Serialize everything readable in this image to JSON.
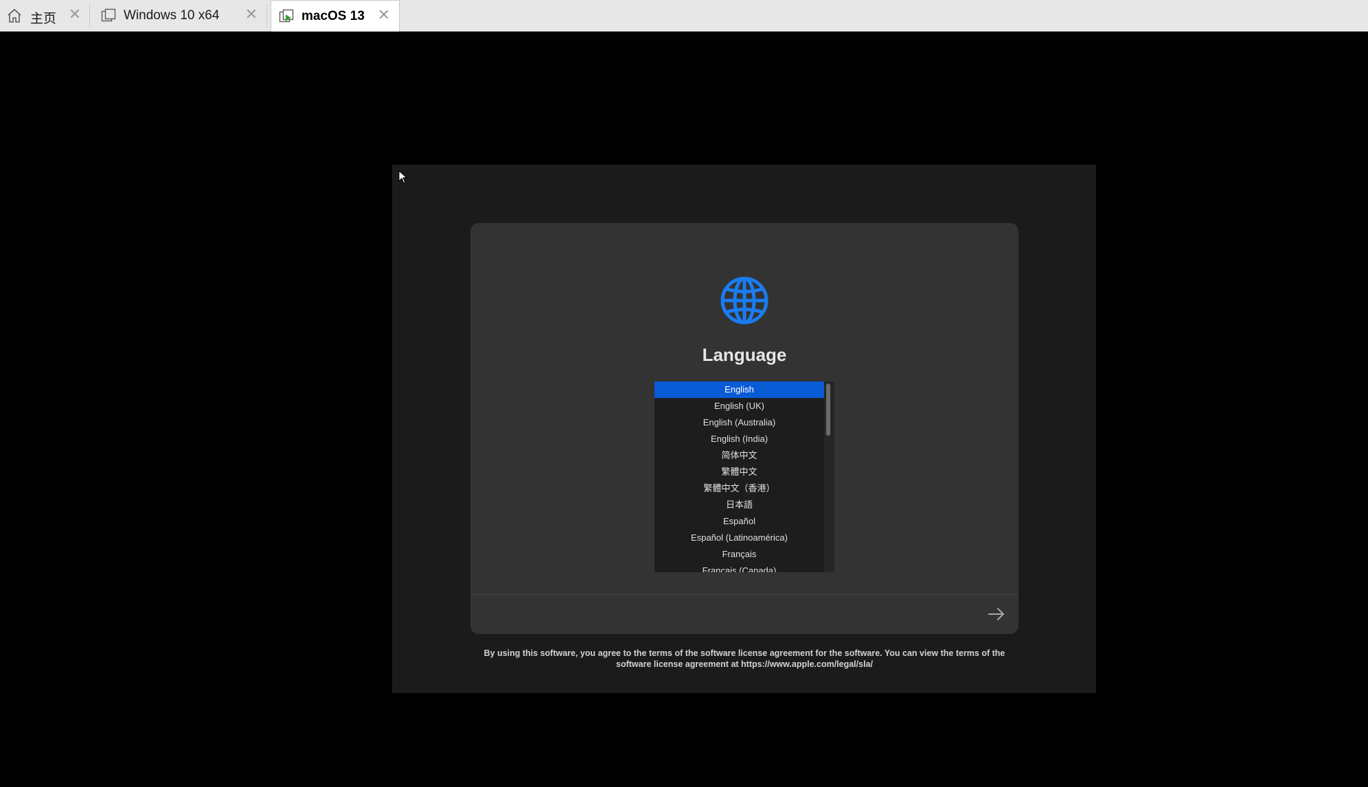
{
  "tabs": [
    {
      "label": "主页",
      "icon": "home-icon",
      "active": false
    },
    {
      "label": "Windows 10 x64",
      "icon": "vm-icon",
      "active": false
    },
    {
      "label": "macOS 13",
      "icon": "vm-running-icon",
      "active": true
    }
  ],
  "tab_close_glyph": "✕",
  "installer": {
    "icon": "globe-icon",
    "title": "Language",
    "languages": [
      "English",
      "English (UK)",
      "English (Australia)",
      "English (India)",
      "简体中文",
      "繁體中文",
      "繁體中文（香港）",
      "日本語",
      "Español",
      "Español (Latinoamérica)",
      "Français",
      "Français (Canada)"
    ],
    "selected_language": "English",
    "next_button_icon": "arrow-right-icon",
    "license_text": "By using this software, you agree to the terms of the software license agreement for the software. You can view the terms of the software license agreement at https://www.apple.com/legal/sla/"
  },
  "colors": {
    "accent_blue": "#0a5bd6",
    "globe_blue": "#1a7cf0",
    "panel_bg": "#333333",
    "screen_bg": "#1b1b1b"
  }
}
